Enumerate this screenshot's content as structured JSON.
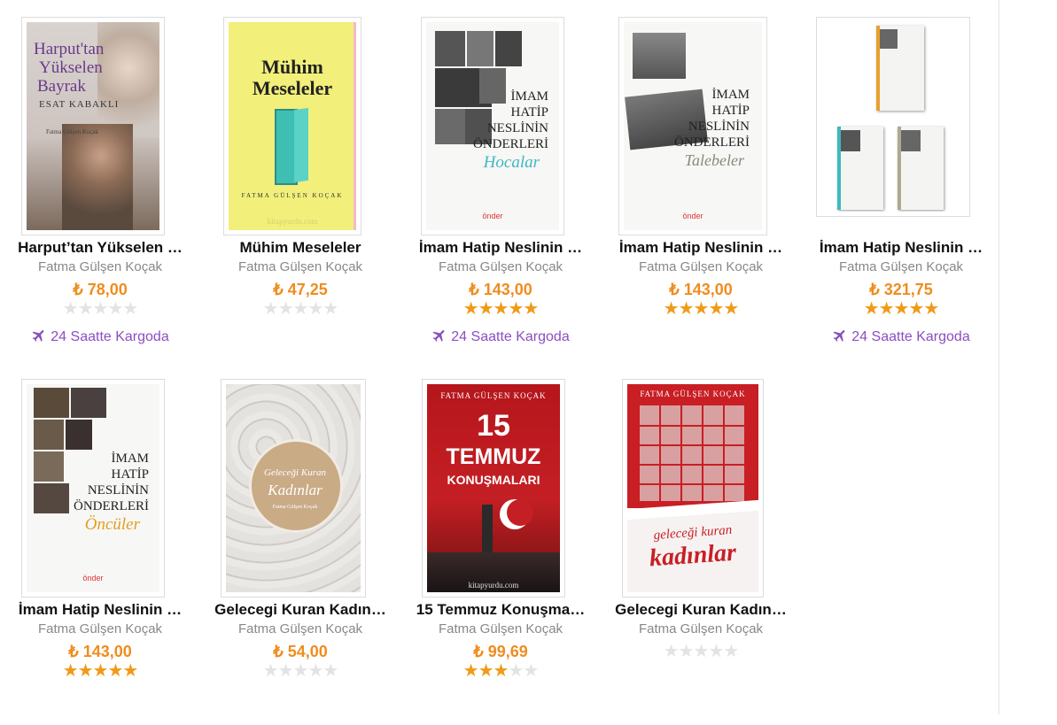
{
  "colors": {
    "price": "#f08c1e",
    "star": "#f09a18",
    "star_empty": "#e3e3e3",
    "cargo": "#8a4fc0"
  },
  "products": [
    {
      "title": "Harput’tan Yükselen …",
      "author": "Fatma Gülşen Koçak",
      "price": "₺ 78,00",
      "rating": 0,
      "cargo": "24 Saatte Kargoda",
      "cover": {
        "line1": "Harput'tan",
        "line2": "Yükselen",
        "line3": "Bayrak",
        "line4": "ESAT KABAKLI",
        "line5": "Fatma Gülşen Koçak"
      }
    },
    {
      "title": "Mühim Meseleler",
      "author": "Fatma Gülşen Koçak",
      "price": "₺ 47,25",
      "rating": 0,
      "cargo": "",
      "cover": {
        "line1": "Mühim",
        "line2": "Meseleler",
        "line3": "FATMA GÜLŞEN KOÇAK",
        "line4": "kitapyurdu.com"
      }
    },
    {
      "title": "İmam Hatip Neslinin …",
      "author": "Fatma Gülşen Koçak",
      "price": "₺ 143,00",
      "rating": 5,
      "cargo": "24 Saatte Kargoda",
      "cover": {
        "line1": "İMAM",
        "line2": "HATİP",
        "line3": "NESLİNİN",
        "line4": "ÖNDERLERİ",
        "line5": "Hocalar",
        "line6": "önder"
      }
    },
    {
      "title": "İmam Hatip Neslinin …",
      "author": "Fatma Gülşen Koçak",
      "price": "₺ 143,00",
      "rating": 5,
      "cargo": "",
      "cover": {
        "line1": "İMAM",
        "line2": "HATİP",
        "line3": "NESLİNİN",
        "line4": "ÖNDERLERİ",
        "line5": "Talebeler",
        "line6": "önder"
      }
    },
    {
      "title": "İmam Hatip Neslinin …",
      "author": "Fatma Gülşen Koçak",
      "price": "₺ 321,75",
      "rating": 5,
      "cargo": "24 Saatte Kargoda",
      "cover": {}
    },
    {
      "title": "İmam Hatip Neslinin …",
      "author": "Fatma Gülşen Koçak",
      "price": "₺ 143,00",
      "rating": 5,
      "cargo": "",
      "cover": {
        "line1": "İMAM",
        "line2": "HATİP",
        "line3": "NESLİNİN",
        "line4": "ÖNDERLERİ",
        "line5": "Öncüler",
        "line6": "önder"
      }
    },
    {
      "title": "Gelecegi Kuran Kadın…",
      "author": "Fatma Gülşen Koçak",
      "price": "₺ 54,00",
      "rating": 0,
      "cargo": "",
      "cover": {
        "line1": "Geleceği Kuran",
        "line2": "Kadınlar",
        "line3": "Fatma Gülşen Koçak"
      }
    },
    {
      "title": "15 Temmuz Konuşma…",
      "author": "Fatma Gülşen Koçak",
      "price": "₺ 99,69",
      "rating": 3,
      "cargo": "",
      "cover": {
        "line1": "FATMA GÜLŞEN KOÇAK",
        "line2": "15",
        "line3": "TEMMUZ",
        "line4": "KONUŞMALARI",
        "line5": "kitapyurdu.com"
      }
    },
    {
      "title": "Gelecegi Kuran Kadın…",
      "author": "Fatma Gülşen Koçak",
      "price": "",
      "rating": 0,
      "cargo": "",
      "cover": {
        "line1": "FATMA GÜLŞEN KOÇAK",
        "line2": "geleceği kuran",
        "line3": "kadınlar"
      }
    }
  ]
}
